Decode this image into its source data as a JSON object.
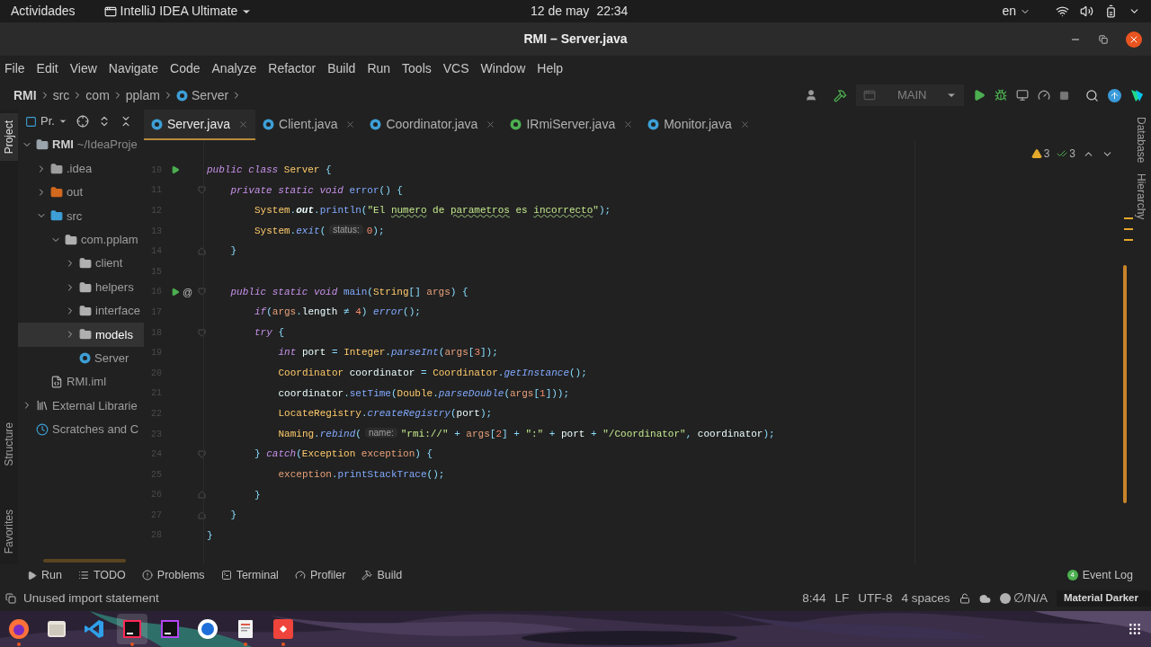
{
  "top_bar": {
    "activities": "Actividades",
    "app_menu": "IntelliJ IDEA Ultimate",
    "date": "12 de may",
    "time": "22:34",
    "language": "en"
  },
  "window": {
    "title": "RMI – Server.java"
  },
  "menu": [
    "File",
    "Edit",
    "View",
    "Navigate",
    "Code",
    "Analyze",
    "Refactor",
    "Build",
    "Run",
    "Tools",
    "VCS",
    "Window",
    "Help"
  ],
  "breadcrumb": [
    {
      "label": "RMI",
      "kind": "module"
    },
    {
      "label": "src",
      "kind": "folder"
    },
    {
      "label": "com",
      "kind": "folder"
    },
    {
      "label": "pplam",
      "kind": "folder"
    },
    {
      "label": "Server",
      "kind": "class"
    }
  ],
  "run_config": {
    "label": "MAIN"
  },
  "left_tool_tabs": [
    {
      "label": "Project",
      "selected": true
    },
    {
      "label": "Structure",
      "selected": false
    },
    {
      "label": "Favorites",
      "selected": false
    }
  ],
  "right_tool_tabs": [
    {
      "label": "Database"
    },
    {
      "label": "Hierarchy"
    }
  ],
  "project_panel": {
    "title": "Pr.",
    "tree": [
      {
        "label": "RMI",
        "path": "~/IdeaProje",
        "kind": "module",
        "expanded": true,
        "selected": false,
        "children": [
          {
            "label": ".idea",
            "kind": "folder",
            "expanded": false,
            "selected": false
          },
          {
            "label": "out",
            "kind": "excluded",
            "expanded": false,
            "selected": false
          },
          {
            "label": "src",
            "kind": "source",
            "expanded": true,
            "selected": false,
            "children": [
              {
                "label": "com.pplam",
                "kind": "package",
                "expanded": true,
                "selected": false,
                "children": [
                  {
                    "label": "client",
                    "kind": "package",
                    "expanded": false,
                    "selected": false
                  },
                  {
                    "label": "helpers",
                    "kind": "package",
                    "expanded": false,
                    "selected": false
                  },
                  {
                    "label": "interface",
                    "kind": "package",
                    "expanded": false,
                    "selected": false
                  },
                  {
                    "label": "models",
                    "kind": "package",
                    "expanded": false,
                    "selected": true
                  },
                  {
                    "label": "Server",
                    "kind": "class",
                    "selected": false
                  }
                ]
              }
            ]
          },
          {
            "label": "RMI.iml",
            "kind": "file",
            "selected": false
          }
        ]
      },
      {
        "label": "External Librarie",
        "kind": "library",
        "expanded": false,
        "selected": false
      },
      {
        "label": "Scratches and C",
        "kind": "scratches",
        "selected": false
      }
    ]
  },
  "editor_tabs": [
    {
      "label": "Server.java",
      "kind": "class",
      "selected": true
    },
    {
      "label": "Client.java",
      "kind": "class",
      "selected": false
    },
    {
      "label": "Coordinator.java",
      "kind": "class",
      "selected": false
    },
    {
      "label": "IRmiServer.java",
      "kind": "interface",
      "selected": false
    },
    {
      "label": "Monitor.java",
      "kind": "class",
      "selected": false
    }
  ],
  "inspections": {
    "warnings": "3",
    "typos": "3"
  },
  "code_lines": [
    {
      "number": "10",
      "run": true,
      "tokens": [
        {
          "text": "public class ",
          "kind": "kw"
        },
        {
          "text": "Server ",
          "kind": "type"
        },
        {
          "text": "{",
          "kind": "punc"
        }
      ]
    },
    {
      "number": "11",
      "fold_start": true,
      "tokens": [
        {
          "text": "private static void ",
          "kind": "kw"
        },
        {
          "text": "error",
          "kind": "fn"
        },
        {
          "text": "() {",
          "kind": "punc"
        }
      ]
    },
    {
      "number": "12",
      "tokens": [
        {
          "text": "System",
          "kind": "type"
        },
        {
          "text": ".",
          "kind": "punc"
        },
        {
          "text": "out",
          "kind": "field"
        },
        {
          "text": ".",
          "kind": "punc"
        },
        {
          "text": "println",
          "kind": "fn"
        },
        {
          "text": "(",
          "kind": "punc"
        },
        {
          "text": "\"El ",
          "kind": "str"
        },
        {
          "text": "numero",
          "kind": "typo"
        },
        {
          "text": " de ",
          "kind": "str"
        },
        {
          "text": "parametros",
          "kind": "typo"
        },
        {
          "text": " es ",
          "kind": "str"
        },
        {
          "text": "incorrecto",
          "kind": "typo"
        },
        {
          "text": "\"",
          "kind": "str"
        },
        {
          "text": ");",
          "kind": "punc"
        }
      ]
    },
    {
      "number": "13",
      "tokens": [
        {
          "text": "System",
          "kind": "type"
        },
        {
          "text": ".",
          "kind": "punc"
        },
        {
          "text": "exit",
          "kind": "sfn"
        },
        {
          "text": "(",
          "kind": "punc"
        },
        {
          "text": "status:",
          "kind": "hint"
        },
        {
          "text": "0",
          "kind": "num"
        },
        {
          "text": ");",
          "kind": "punc"
        }
      ]
    },
    {
      "number": "14",
      "fold_end": true,
      "tokens": [
        {
          "text": "}",
          "kind": "punc"
        }
      ]
    },
    {
      "number": "15"
    },
    {
      "number": "16",
      "run": true,
      "annotation": "@",
      "fold_start": true,
      "tokens": [
        {
          "text": "public static void ",
          "kind": "kw"
        },
        {
          "text": "main",
          "kind": "fn"
        },
        {
          "text": "(",
          "kind": "punc"
        },
        {
          "text": "String",
          "kind": "type"
        },
        {
          "text": "[] ",
          "kind": "punc"
        },
        {
          "text": "args",
          "kind": "param"
        },
        {
          "text": ") {",
          "kind": "punc"
        }
      ]
    },
    {
      "number": "17",
      "tokens": [
        {
          "text": "if",
          "kind": "kw"
        },
        {
          "text": "(",
          "kind": "punc"
        },
        {
          "text": "args",
          "kind": "param"
        },
        {
          "text": ".",
          "kind": "punc"
        },
        {
          "text": "length ",
          "kind": "var"
        },
        {
          "text": "≠ ",
          "kind": "punc"
        },
        {
          "text": "4",
          "kind": "num"
        },
        {
          "text": ") ",
          "kind": "punc"
        },
        {
          "text": "error",
          "kind": "sfn"
        },
        {
          "text": "();",
          "kind": "punc"
        }
      ]
    },
    {
      "number": "18",
      "fold_start": true,
      "tokens": [
        {
          "text": "try ",
          "kind": "kw"
        },
        {
          "text": "{",
          "kind": "punc"
        }
      ]
    },
    {
      "number": "19",
      "tokens": [
        {
          "text": "int ",
          "kind": "kw"
        },
        {
          "text": "port ",
          "kind": "var"
        },
        {
          "text": "= ",
          "kind": "punc"
        },
        {
          "text": "Integer",
          "kind": "type"
        },
        {
          "text": ".",
          "kind": "punc"
        },
        {
          "text": "parseInt",
          "kind": "sfn"
        },
        {
          "text": "(",
          "kind": "punc"
        },
        {
          "text": "args",
          "kind": "param"
        },
        {
          "text": "[",
          "kind": "punc"
        },
        {
          "text": "3",
          "kind": "num"
        },
        {
          "text": "]);",
          "kind": "punc"
        }
      ]
    },
    {
      "number": "20",
      "tokens": [
        {
          "text": "Coordinator ",
          "kind": "type"
        },
        {
          "text": "coordinator ",
          "kind": "var"
        },
        {
          "text": "= ",
          "kind": "punc"
        },
        {
          "text": "Coordinator",
          "kind": "type"
        },
        {
          "text": ".",
          "kind": "punc"
        },
        {
          "text": "getInstance",
          "kind": "sfn"
        },
        {
          "text": "();",
          "kind": "punc"
        }
      ]
    },
    {
      "number": "21",
      "tokens": [
        {
          "text": "coordinator",
          "kind": "var"
        },
        {
          "text": ".",
          "kind": "punc"
        },
        {
          "text": "setTime",
          "kind": "fn"
        },
        {
          "text": "(",
          "kind": "punc"
        },
        {
          "text": "Double",
          "kind": "type"
        },
        {
          "text": ".",
          "kind": "punc"
        },
        {
          "text": "parseDouble",
          "kind": "sfn"
        },
        {
          "text": "(",
          "kind": "punc"
        },
        {
          "text": "args",
          "kind": "param"
        },
        {
          "text": "[",
          "kind": "punc"
        },
        {
          "text": "1",
          "kind": "num"
        },
        {
          "text": "]));",
          "kind": "punc"
        }
      ]
    },
    {
      "number": "22",
      "tokens": [
        {
          "text": "LocateRegistry",
          "kind": "type"
        },
        {
          "text": ".",
          "kind": "punc"
        },
        {
          "text": "createRegistry",
          "kind": "sfn"
        },
        {
          "text": "(",
          "kind": "punc"
        },
        {
          "text": "port",
          "kind": "var"
        },
        {
          "text": ");",
          "kind": "punc"
        }
      ]
    },
    {
      "number": "23",
      "tokens": [
        {
          "text": "Naming",
          "kind": "type"
        },
        {
          "text": ".",
          "kind": "punc"
        },
        {
          "text": "rebind",
          "kind": "sfn"
        },
        {
          "text": "(",
          "kind": "punc"
        },
        {
          "text": "name:",
          "kind": "hint"
        },
        {
          "text": "\"rmi://\"",
          "kind": "str"
        },
        {
          "text": " + ",
          "kind": "punc"
        },
        {
          "text": "args",
          "kind": "param"
        },
        {
          "text": "[",
          "kind": "punc"
        },
        {
          "text": "2",
          "kind": "num"
        },
        {
          "text": "] + ",
          "kind": "punc"
        },
        {
          "text": "\":\"",
          "kind": "str"
        },
        {
          "text": " + ",
          "kind": "punc"
        },
        {
          "text": "port",
          "kind": "var"
        },
        {
          "text": " + ",
          "kind": "punc"
        },
        {
          "text": "\"/Coordinator\"",
          "kind": "str"
        },
        {
          "text": ", ",
          "kind": "punc"
        },
        {
          "text": "coordinator",
          "kind": "var"
        },
        {
          "text": ");",
          "kind": "punc"
        }
      ]
    },
    {
      "number": "24",
      "fold_start": true,
      "tokens": [
        {
          "text": "} ",
          "kind": "punc"
        },
        {
          "text": "catch",
          "kind": "kw"
        },
        {
          "text": "(",
          "kind": "punc"
        },
        {
          "text": "Exception ",
          "kind": "type"
        },
        {
          "text": "exception",
          "kind": "param"
        },
        {
          "text": ") {",
          "kind": "punc"
        }
      ]
    },
    {
      "number": "25",
      "tokens": [
        {
          "text": "exception",
          "kind": "param"
        },
        {
          "text": ".",
          "kind": "punc"
        },
        {
          "text": "printStackTrace",
          "kind": "fn"
        },
        {
          "text": "();",
          "kind": "punc"
        }
      ]
    },
    {
      "number": "26",
      "fold_end": true,
      "tokens": [
        {
          "text": "}",
          "kind": "punc"
        }
      ]
    },
    {
      "number": "27",
      "fold_end": true,
      "tokens": [
        {
          "text": "}",
          "kind": "punc"
        }
      ]
    },
    {
      "number": "28",
      "tokens": [
        {
          "text": "}",
          "kind": "punc"
        }
      ]
    }
  ],
  "tool_windows": [
    {
      "label": "Run",
      "kind": "run"
    },
    {
      "label": "TODO",
      "kind": "todo"
    },
    {
      "label": "Problems",
      "kind": "problems"
    },
    {
      "label": "Terminal",
      "kind": "terminal"
    },
    {
      "label": "Profiler",
      "kind": "profiler"
    },
    {
      "label": "Build",
      "kind": "build"
    }
  ],
  "event_log": {
    "label": "Event Log",
    "badge": "4"
  },
  "status_bar": {
    "message": "Unused import statement",
    "position": "8:44",
    "line_separator": "LF",
    "encoding": "UTF-8",
    "indent": "4 spaces",
    "vcs": "∅/N/A",
    "theme": "Material Darker"
  },
  "dock": [
    {
      "kind": "firefox",
      "selected": false,
      "running": true
    },
    {
      "kind": "files",
      "selected": false,
      "running": false
    },
    {
      "kind": "vscode",
      "selected": false,
      "running": false
    },
    {
      "kind": "intellij",
      "selected": true,
      "running": true
    },
    {
      "kind": "phpstorm",
      "selected": false,
      "running": false
    },
    {
      "kind": "webstorm",
      "selected": false,
      "running": false
    },
    {
      "kind": "text-editor",
      "selected": false,
      "running": true
    },
    {
      "kind": "anydesk",
      "selected": false,
      "running": true
    }
  ]
}
